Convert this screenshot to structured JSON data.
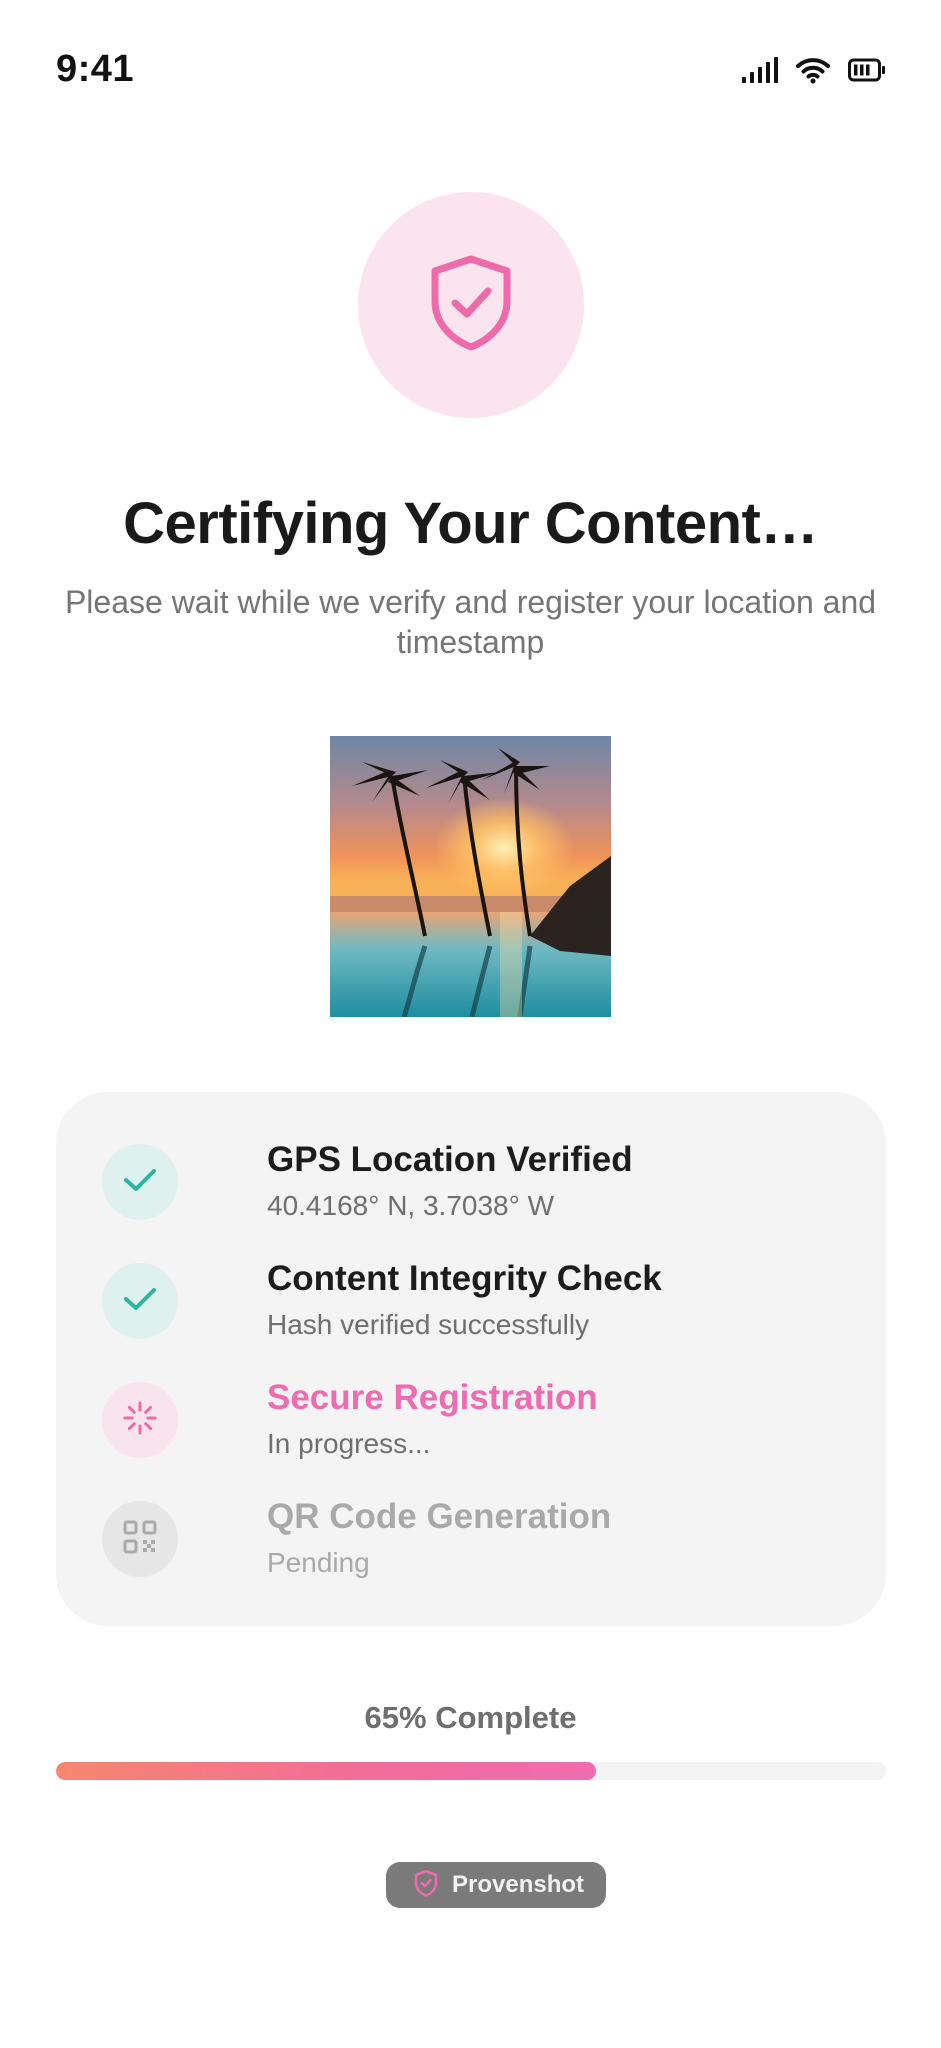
{
  "status_bar": {
    "time": "9:41"
  },
  "header": {
    "title": "Certifying Your Content…",
    "subtitle": "Please wait while we verify and register your location and timestamp"
  },
  "steps": [
    {
      "title": "GPS Location Verified",
      "detail": "40.4168° N, 3.7038° W",
      "state": "done",
      "icon": "check-icon"
    },
    {
      "title": "Content Integrity Check",
      "detail": "Hash verified successfully",
      "state": "done",
      "icon": "check-icon"
    },
    {
      "title": "Secure Registration",
      "detail": "In progress...",
      "state": "in-progress",
      "icon": "spinner-icon"
    },
    {
      "title": "QR Code Generation",
      "detail": "Pending",
      "state": "pending",
      "icon": "qr-code-icon"
    }
  ],
  "progress": {
    "label": "65% Complete",
    "value": 0.65
  },
  "brand": {
    "name": "Provenshot"
  },
  "colors": {
    "accent_pink": "#ef6cb0",
    "done_teal": "#2bb5a3",
    "done_bg": "#dff1ee",
    "pending_gray": "#a9a9a9"
  }
}
